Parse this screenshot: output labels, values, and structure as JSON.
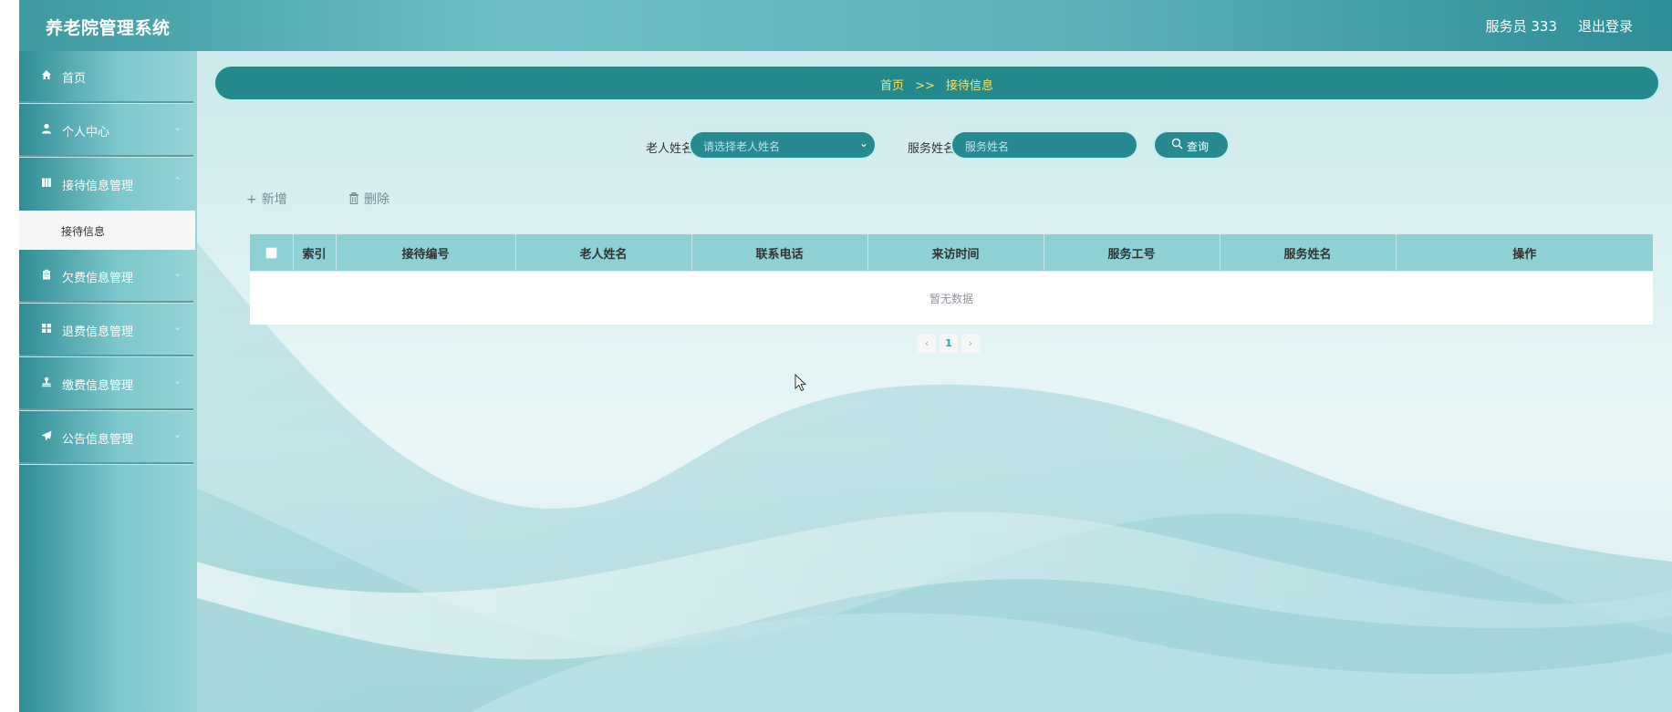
{
  "app": {
    "title": "养老院管理系统"
  },
  "header": {
    "user": "服务员 333",
    "logout": "退出登录"
  },
  "sidebar": {
    "items": [
      {
        "label": "首页",
        "icon": "home-icon"
      },
      {
        "label": "个人中心",
        "icon": "user-icon"
      },
      {
        "label": "接待信息管理",
        "icon": "book-icon"
      },
      {
        "label": "欠费信息管理",
        "icon": "clipboard-icon"
      },
      {
        "label": "退费信息管理",
        "icon": "grid-icon"
      },
      {
        "label": "缴费信息管理",
        "icon": "stamp-icon"
      },
      {
        "label": "公告信息管理",
        "icon": "paper-plane-icon"
      }
    ],
    "active_sub": "接待信息"
  },
  "breadcrumb": {
    "home": "首页",
    "separator": ">>",
    "current": "接待信息"
  },
  "filters": {
    "elder_label": "老人姓名",
    "elder_placeholder": "请选择老人姓名",
    "service_label": "服务姓名",
    "service_placeholder": "服务姓名",
    "search_label": "查询"
  },
  "actions": {
    "add": "新增",
    "delete": "删除"
  },
  "table": {
    "columns": [
      "索引",
      "接待编号",
      "老人姓名",
      "联系电话",
      "来访时间",
      "服务工号",
      "服务姓名",
      "操作"
    ],
    "empty_text": "暂无数据"
  },
  "pagination": {
    "prev": "‹",
    "current_page": "1",
    "next": "›"
  },
  "colors": {
    "accent": "#268a90",
    "breadcrumb_text": "#ffe15a",
    "table_header": "#8fd0d4"
  }
}
